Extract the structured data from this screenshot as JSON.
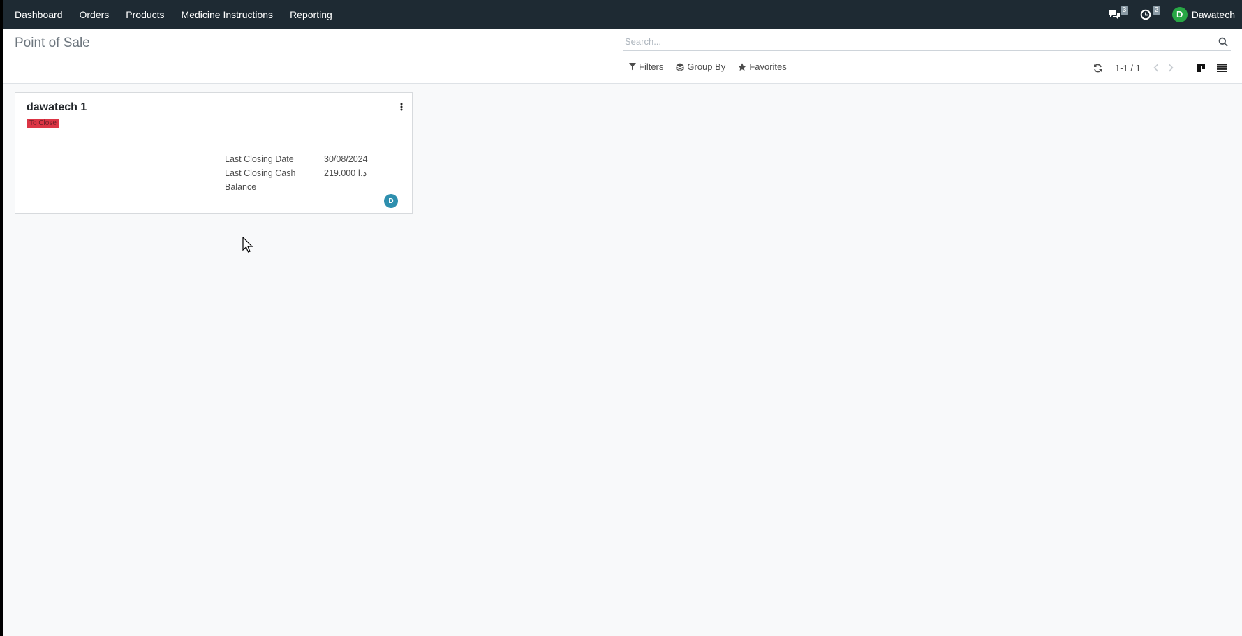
{
  "navbar": {
    "menu": [
      "Dashboard",
      "Orders",
      "Products",
      "Medicine Instructions",
      "Reporting"
    ],
    "messages_icon": "comments-icon",
    "messages_count": "3",
    "activities_icon": "clock-icon",
    "activities_count": "2",
    "user_initial": "D",
    "user_name": "Dawatech",
    "bg_color": "#1e2a33"
  },
  "control_panel": {
    "title": "Point of Sale",
    "search_placeholder": "Search...",
    "filters_label": "Filters",
    "group_by_label": "Group By",
    "favorites_label": "Favorites",
    "pager_value": "1-1 / 1",
    "active_view": "kanban"
  },
  "card": {
    "title": "dawatech 1",
    "status_badge": "To Close",
    "status_color": "#dc3545",
    "last_closing_date_label": "Last Closing Date",
    "last_closing_date_value": "30/08/2024",
    "last_closing_cash_label": "Last Closing Cash",
    "last_closing_cash_label_2": "Balance",
    "last_closing_cash_value": "219.000 د.ا",
    "avatar_initial": "D",
    "avatar_color": "#2e8fae"
  }
}
